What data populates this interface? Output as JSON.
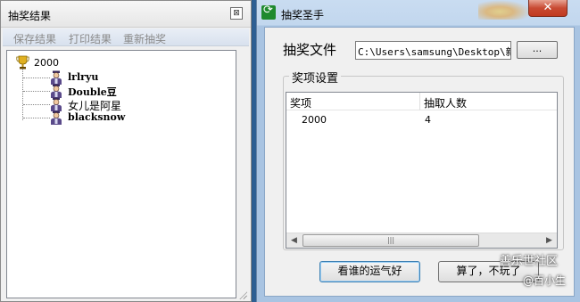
{
  "left_window": {
    "title": "抽奖结果",
    "close_label": "⊠",
    "menu": [
      "保存结果",
      "打印结果",
      "重新抽奖"
    ],
    "tree": {
      "root": "2000",
      "children": [
        "lrlryu",
        "Double豆",
        "女儿是阿星",
        "blacksnow"
      ]
    }
  },
  "right_window": {
    "title": "抽奖圣手",
    "close_label": "✕",
    "file_label": "抽奖文件",
    "file_path": "C:\\Users\\samsung\\Desktop\\新建",
    "browse_label": "...",
    "group_label": "奖项设置",
    "columns": [
      "奖项",
      "抽取人数"
    ],
    "rows": [
      {
        "prize": "2000",
        "count": "4"
      }
    ],
    "start_button": "看谁的运气好",
    "quit_button": "算了，不玩了"
  },
  "watermark": {
    "line1": "善乐世社区",
    "line2": "@百小生"
  },
  "colors": {
    "close_red": "#c84a33",
    "title_blue": "#c9dcf1",
    "menu_gray": "#8a8a8a"
  },
  "icons": {
    "root": "trophy-icon",
    "child": "person-icon",
    "app": "app-refresh-icon"
  }
}
